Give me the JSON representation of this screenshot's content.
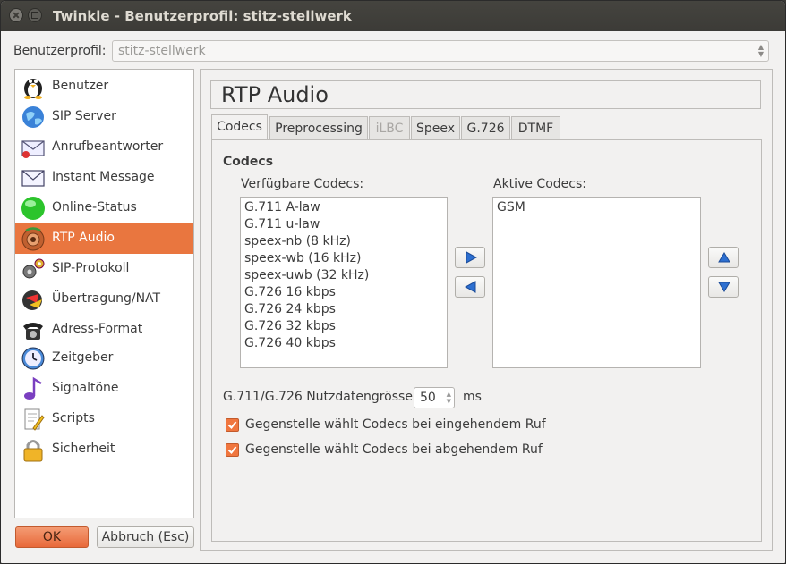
{
  "window": {
    "title": "Twinkle - Benutzerprofil: stitz-stellwerk"
  },
  "profile": {
    "label": "Benutzerprofil:",
    "value": "stitz-stellwerk"
  },
  "sidebar": {
    "items": [
      {
        "label": "Benutzer",
        "icon": "penguin-icon"
      },
      {
        "label": "SIP Server",
        "icon": "globe-icon"
      },
      {
        "label": "Anrufbeantworter",
        "icon": "voicemail-envelope-icon"
      },
      {
        "label": "Instant Message",
        "icon": "envelope-icon"
      },
      {
        "label": "Online-Status",
        "icon": "green-status-icon"
      },
      {
        "label": "RTP Audio",
        "icon": "speaker-icon",
        "active": true
      },
      {
        "label": "SIP-Protokoll",
        "icon": "gears-icon"
      },
      {
        "label": "Übertragung/NAT",
        "icon": "transfer-icon"
      },
      {
        "label": "Adress-Format",
        "icon": "telephone-icon"
      },
      {
        "label": "Zeitgeber",
        "icon": "clock-icon"
      },
      {
        "label": "Signaltöne",
        "icon": "music-note-icon"
      },
      {
        "label": "Scripts",
        "icon": "script-icon"
      },
      {
        "label": "Sicherheit",
        "icon": "padlock-icon"
      }
    ]
  },
  "buttons": {
    "ok": "OK",
    "cancel": "Abbruch (Esc)"
  },
  "page": {
    "heading": "RTP Audio"
  },
  "tabs": [
    {
      "label": "Codecs",
      "active": true
    },
    {
      "label": "Preprocessing"
    },
    {
      "label": "iLBC",
      "disabled": true
    },
    {
      "label": "Speex"
    },
    {
      "label": "G.726"
    },
    {
      "label": "DTMF"
    }
  ],
  "codecs": {
    "section": "Codecs",
    "available_label": "Verfügbare Codecs:",
    "active_label": "Aktive Codecs:",
    "available": [
      "G.711 A-law",
      "G.711 u-law",
      "speex-nb (8 kHz)",
      "speex-wb (16 kHz)",
      "speex-uwb (32 kHz)",
      "G.726 16 kbps",
      "G.726 24 kbps",
      "G.726 32 kbps",
      "G.726 40 kbps"
    ],
    "active": [
      "GSM"
    ],
    "payload_label": "G.711/G.726 Nutzdatengrösse:",
    "payload_value": "50",
    "payload_unit": "ms",
    "incoming_label": "Gegenstelle wählt Codecs bei eingehendem Ruf",
    "outgoing_label": "Gegenstelle wählt Codecs bei abgehendem Ruf",
    "incoming_checked": true,
    "outgoing_checked": true
  },
  "colors": {
    "accent": "#e9763f",
    "titlebar": "#3c3b37",
    "window": "#f2f1f0"
  }
}
